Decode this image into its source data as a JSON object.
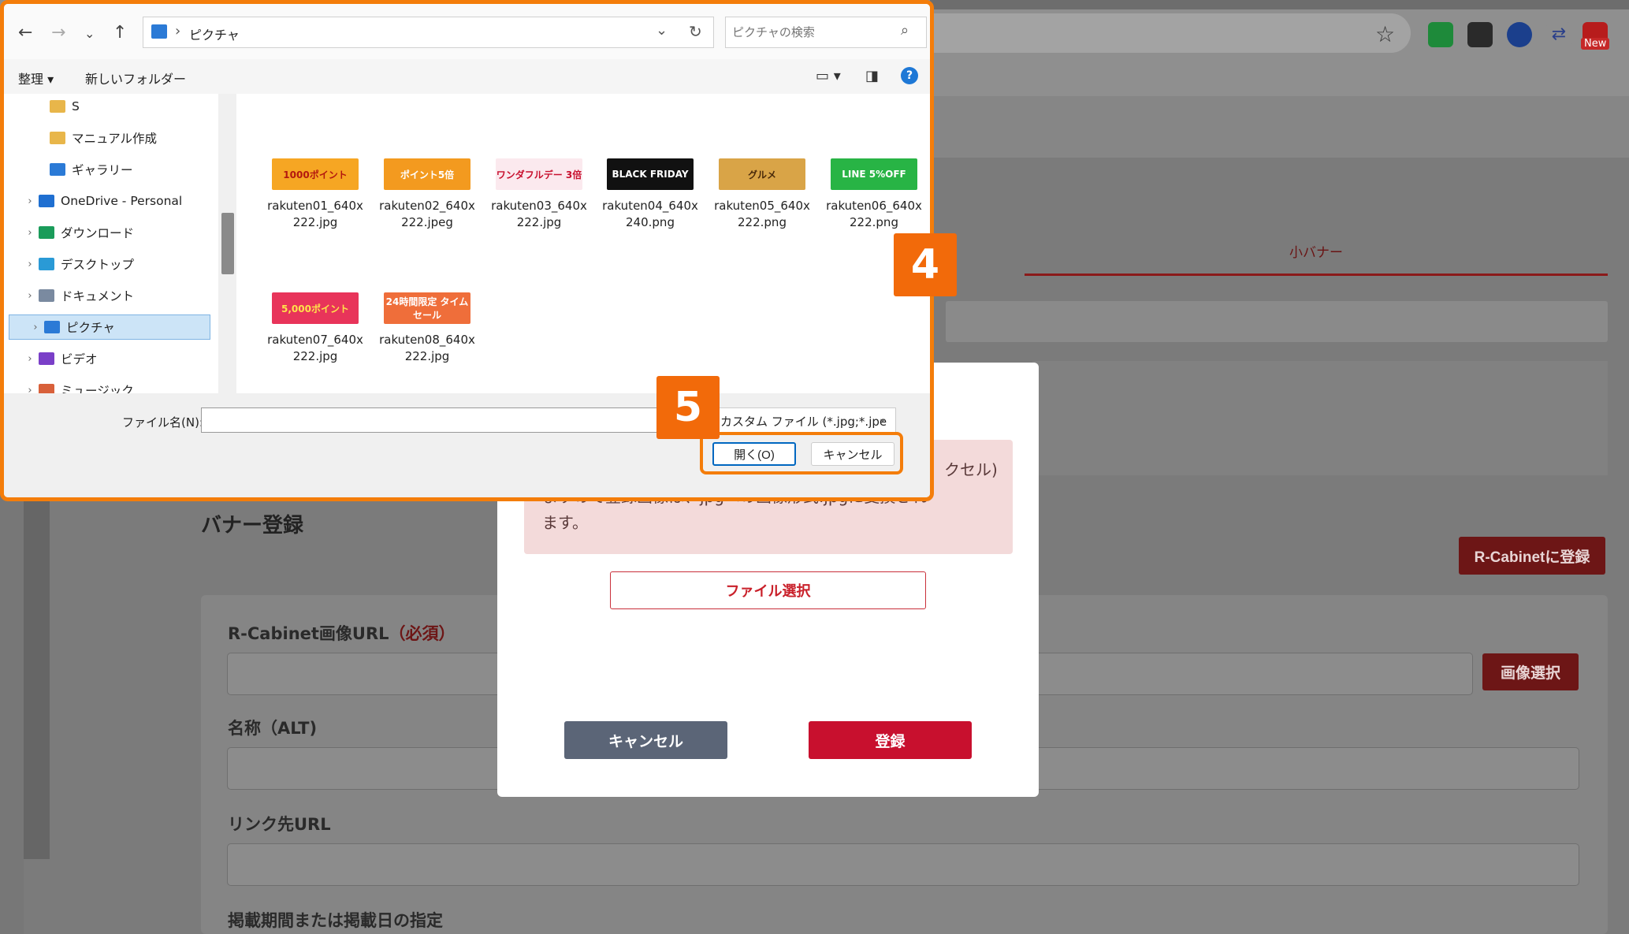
{
  "browser": {
    "new_badge": "New"
  },
  "page": {
    "tab_small": "小バナー",
    "section_title": "バナー登録",
    "rcabinet_btn": "R-Cabinetに登録",
    "url_label": "R-Cabinet画像URL",
    "url_required": "（必須）",
    "image_select_btn": "画像選択",
    "alt_label": "名称（ALT)",
    "link_label": "リンク先URL",
    "period_label": "掲載期間または掲載日の指定",
    "paren_fragment": ")"
  },
  "modal": {
    "notice_fragment": "クセル)",
    "notice_line1": "ますので登録画像は、jpgへの画像形式.jpgに変換され",
    "notice_line2": "ます。",
    "file_select_btn": "ファイル選択",
    "cancel_btn": "キャンセル",
    "submit_btn": "登録"
  },
  "dialog": {
    "path_location": "ピクチャ",
    "search_placeholder": "ピクチャの検索",
    "cmd_organize": "整理 ▾",
    "cmd_new_folder": "新しいフォルダー",
    "tree": [
      {
        "label": "S",
        "icon": "folder-icon",
        "color": "#e8b64a",
        "expandable": false,
        "selected": false
      },
      {
        "label": "マニュアル作成",
        "icon": "folder-icon",
        "color": "#e8b64a",
        "expandable": false,
        "selected": false
      },
      {
        "label": "ギャラリー",
        "icon": "gallery-icon",
        "color": "#2b7ad6",
        "expandable": false,
        "selected": false
      },
      {
        "label": "OneDrive - Personal",
        "icon": "onedrive-icon",
        "color": "#1f6fd1",
        "expandable": true,
        "selected": false
      },
      {
        "label": "ダウンロード",
        "icon": "download-icon",
        "color": "#1a9c5a",
        "expandable": true,
        "selected": false
      },
      {
        "label": "デスクトップ",
        "icon": "desktop-icon",
        "color": "#2a9ad6",
        "expandable": true,
        "selected": false
      },
      {
        "label": "ドキュメント",
        "icon": "document-icon",
        "color": "#7a8aa0",
        "expandable": true,
        "selected": false
      },
      {
        "label": "ピクチャ",
        "icon": "pictures-icon",
        "color": "#2b7ad6",
        "expandable": true,
        "selected": true
      },
      {
        "label": "ビデオ",
        "icon": "video-icon",
        "color": "#7a3fc8",
        "expandable": true,
        "selected": false
      },
      {
        "label": "ミュージック",
        "icon": "music-icon",
        "color": "#d8603a",
        "expandable": true,
        "selected": false
      }
    ],
    "files": [
      {
        "name1": "rakuten01_640x",
        "name2": "222.jpg",
        "thumb_text": "1000ポイント",
        "thumb_bg": "#f6a623",
        "thumb_color": "#b3180f"
      },
      {
        "name1": "rakuten02_640x",
        "name2": "222.jpeg",
        "thumb_text": "ポイント5倍",
        "thumb_bg": "#f39a1f",
        "thumb_color": "#ffffff"
      },
      {
        "name1": "rakuten03_640x",
        "name2": "222.jpg",
        "thumb_text": "ワンダフルデー 3倍",
        "thumb_bg": "#fbe9ee",
        "thumb_color": "#c8102e"
      },
      {
        "name1": "rakuten04_640x",
        "name2": "240.png",
        "thumb_text": "BLACK FRIDAY",
        "thumb_bg": "#111111",
        "thumb_color": "#ffffff"
      },
      {
        "name1": "rakuten05_640x",
        "name2": "222.png",
        "thumb_text": "グルメ",
        "thumb_bg": "#d9a447",
        "thumb_color": "#4a2a0a"
      },
      {
        "name1": "rakuten06_640x",
        "name2": "222.png",
        "thumb_text": "LINE 5%OFF",
        "thumb_bg": "#28b445",
        "thumb_color": "#ffffff"
      },
      {
        "name1": "rakuten07_640x",
        "name2": "222.jpg",
        "thumb_text": "5,000ポイント",
        "thumb_bg": "#e8345a",
        "thumb_color": "#ffe14a"
      },
      {
        "name1": "rakuten08_640x",
        "name2": "222.jpg",
        "thumb_text": "24時間限定 タイムセール",
        "thumb_bg": "#ef6e3a",
        "thumb_color": "#ffffff"
      }
    ],
    "filename_label": "ファイル名(N):",
    "filename_value": "",
    "filter_value": "カスタム ファイル (*.jpg;*.jpe",
    "open_btn": "開く(O)",
    "cancel_btn": "キャンセル"
  },
  "steps": {
    "step4": "4",
    "step5": "5"
  },
  "colors": {
    "highlight": "#f47d0a",
    "brand_red": "#c8102e",
    "selection": "#cce4f7"
  }
}
